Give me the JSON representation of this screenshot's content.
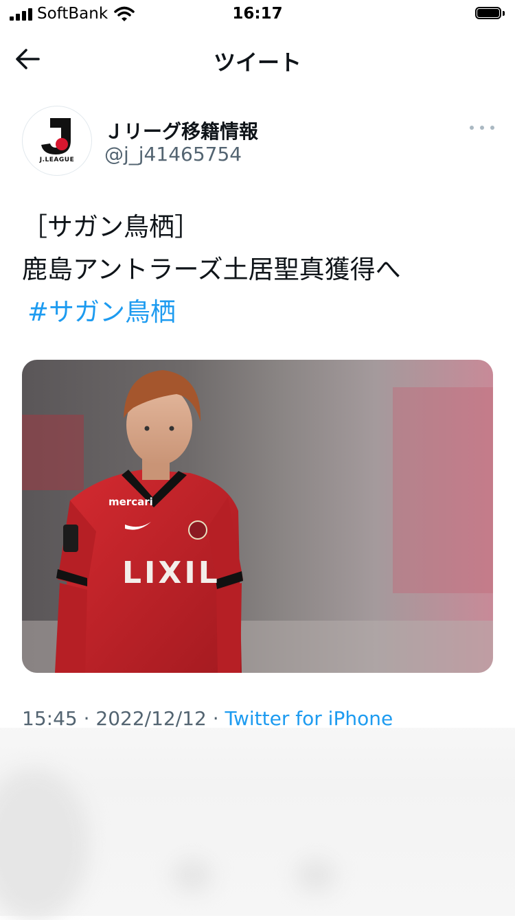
{
  "status_bar": {
    "carrier": "SoftBank",
    "time": "16:17",
    "icons": [
      "signal-icon",
      "wifi-icon",
      "battery-icon"
    ]
  },
  "header": {
    "title": "ツイート",
    "back_icon": "arrow-left-icon"
  },
  "tweet": {
    "author": {
      "name": "Ｊリーグ移籍情報",
      "handle": "@j_j41465754",
      "avatar_label": "J.LEAGUE"
    },
    "text_line1": "［サガン鳥栖］",
    "text_line2": "鹿島アントラーズ土居聖真獲得へ",
    "hashtag": "#サガン鳥栖",
    "media": {
      "jersey_sponsor": "LIXIL",
      "sleeve_sponsor": "mercari",
      "kit_color": "#c8242b"
    },
    "time": "15:45",
    "date": "2022/12/12",
    "separator": "·",
    "source": "Twitter for iPhone"
  },
  "colors": {
    "link": "#1d9bf0",
    "secondary_text": "#536471"
  }
}
